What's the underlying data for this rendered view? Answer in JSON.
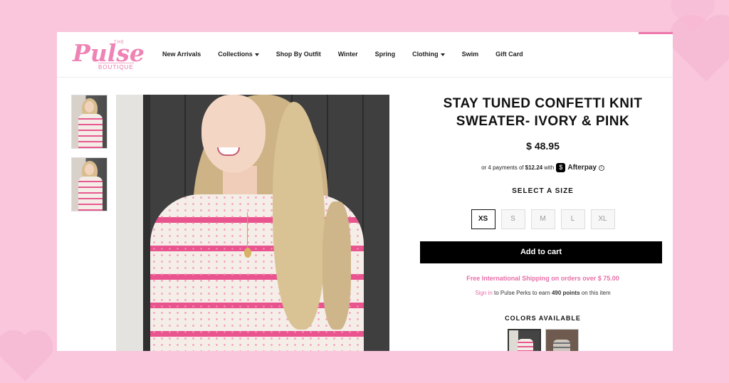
{
  "brand": {
    "logo_the": "THE",
    "logo_main": "Pulse",
    "logo_sub": "BOUTIQUE"
  },
  "nav": [
    {
      "label": "New Arrivals",
      "dropdown": false
    },
    {
      "label": "Collections",
      "dropdown": true
    },
    {
      "label": "Shop By Outfit",
      "dropdown": false
    },
    {
      "label": "Winter",
      "dropdown": false
    },
    {
      "label": "Spring",
      "dropdown": false
    },
    {
      "label": "Clothing",
      "dropdown": true
    },
    {
      "label": "Swim",
      "dropdown": false
    },
    {
      "label": "Gift Card",
      "dropdown": false
    }
  ],
  "product": {
    "title_line1": "STAY TUNED CONFETTI KNIT",
    "title_line2": "SWEATER- IVORY & PINK",
    "price": "$ 48.95",
    "afterpay": {
      "prefix": "or 4 payments of",
      "amount": "$12.24",
      "with": "with",
      "badge": "$",
      "provider": "Afterpay",
      "info": "i"
    },
    "select_size_label": "SELECT A SIZE",
    "sizes": [
      "XS",
      "S",
      "M",
      "L",
      "XL"
    ],
    "selected_size": "XS",
    "add_to_cart": "Add to cart",
    "shipping": "Free International Shipping on orders over $ 75.00",
    "perks": {
      "signin": "Sign in",
      "text1": " to Pulse Perks to earn ",
      "points": "490 points",
      "text2": " on this item"
    },
    "colors_title": "COLORS AVAILABLE"
  },
  "colors": {
    "accent_pink": "#ee78ad",
    "button_black": "#000000",
    "background_pink": "#f9c6dc"
  }
}
